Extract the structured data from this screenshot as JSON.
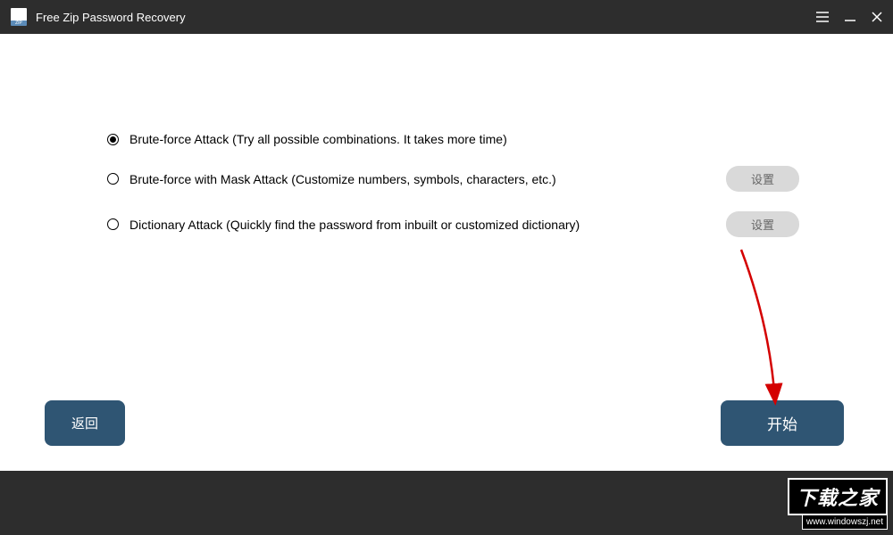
{
  "titlebar": {
    "title": "Free Zip Password Recovery"
  },
  "options": [
    {
      "label": "Brute-force Attack (Try all possible combinations. It takes more time)",
      "selected": true,
      "has_settings": false
    },
    {
      "label": "Brute-force with Mask Attack (Customize numbers, symbols, characters, etc.)",
      "selected": false,
      "has_settings": true,
      "settings_label": "设置"
    },
    {
      "label": "Dictionary Attack (Quickly find the password from inbuilt or customized dictionary)",
      "selected": false,
      "has_settings": true,
      "settings_label": "设置"
    }
  ],
  "buttons": {
    "back": "返回",
    "start": "开始"
  },
  "watermark": {
    "cn": "下载之家",
    "url": "www.windowszj.net"
  }
}
